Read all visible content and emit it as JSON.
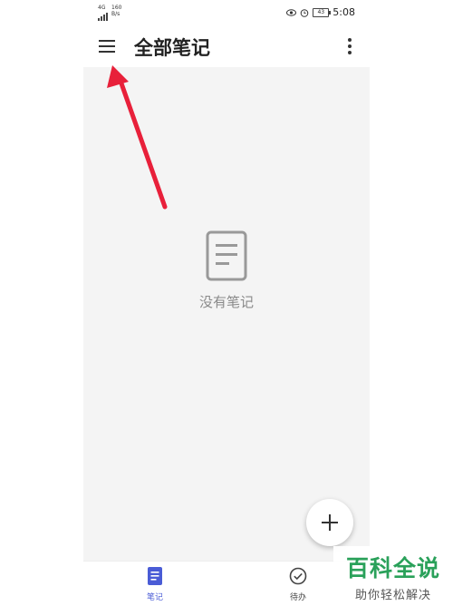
{
  "status_bar": {
    "network": "4G",
    "speed_value": "160",
    "speed_unit": "B/s",
    "battery": "43",
    "time": "5:08"
  },
  "header": {
    "title": "全部笔记"
  },
  "empty_state": {
    "message": "没有笔记"
  },
  "bottom_nav": {
    "items": [
      {
        "label": "笔记",
        "icon": "notes-icon",
        "active": true
      },
      {
        "label": "待办",
        "icon": "todo-check-icon",
        "active": false
      }
    ]
  },
  "watermark": {
    "title": "百科全说",
    "subtitle": "助你轻松解决"
  },
  "colors": {
    "accent": "#4a5cd6",
    "background": "#f4f4f4",
    "arrow": "#e8203a",
    "watermark_green": "#2aa15a"
  }
}
